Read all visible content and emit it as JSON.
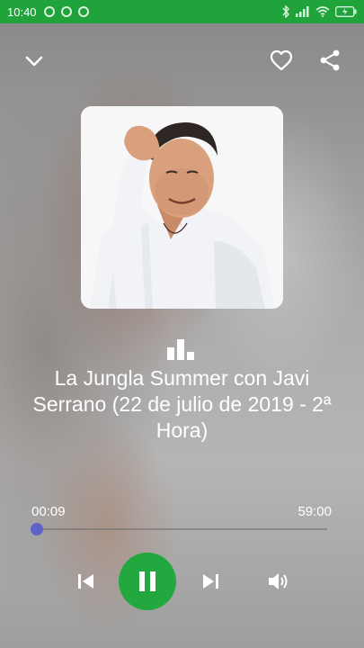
{
  "status_bar": {
    "time": "10:40",
    "battery_icon": "battery-icon",
    "wifi_icon": "wifi-icon",
    "signal_icon": "signal-icon",
    "bluetooth_icon": "bluetooth-icon",
    "color": "#1fa33a"
  },
  "player": {
    "title": "La Jungla Summer con Javi Serrano (22 de julio de 2019 - 2ª Hora)",
    "current_time": "00:09",
    "total_time": "59:00",
    "progress_fraction": 0.003,
    "accent": "#5f63c7",
    "play_button_color": "#22a83f",
    "state": "playing"
  },
  "icons": {
    "collapse": "chevron-down-icon",
    "favorite": "heart-icon",
    "share": "share-icon",
    "equalizer": "equalizer-icon",
    "previous": "skip-previous-icon",
    "pause": "pause-icon",
    "next": "skip-next-icon",
    "volume": "volume-icon"
  }
}
